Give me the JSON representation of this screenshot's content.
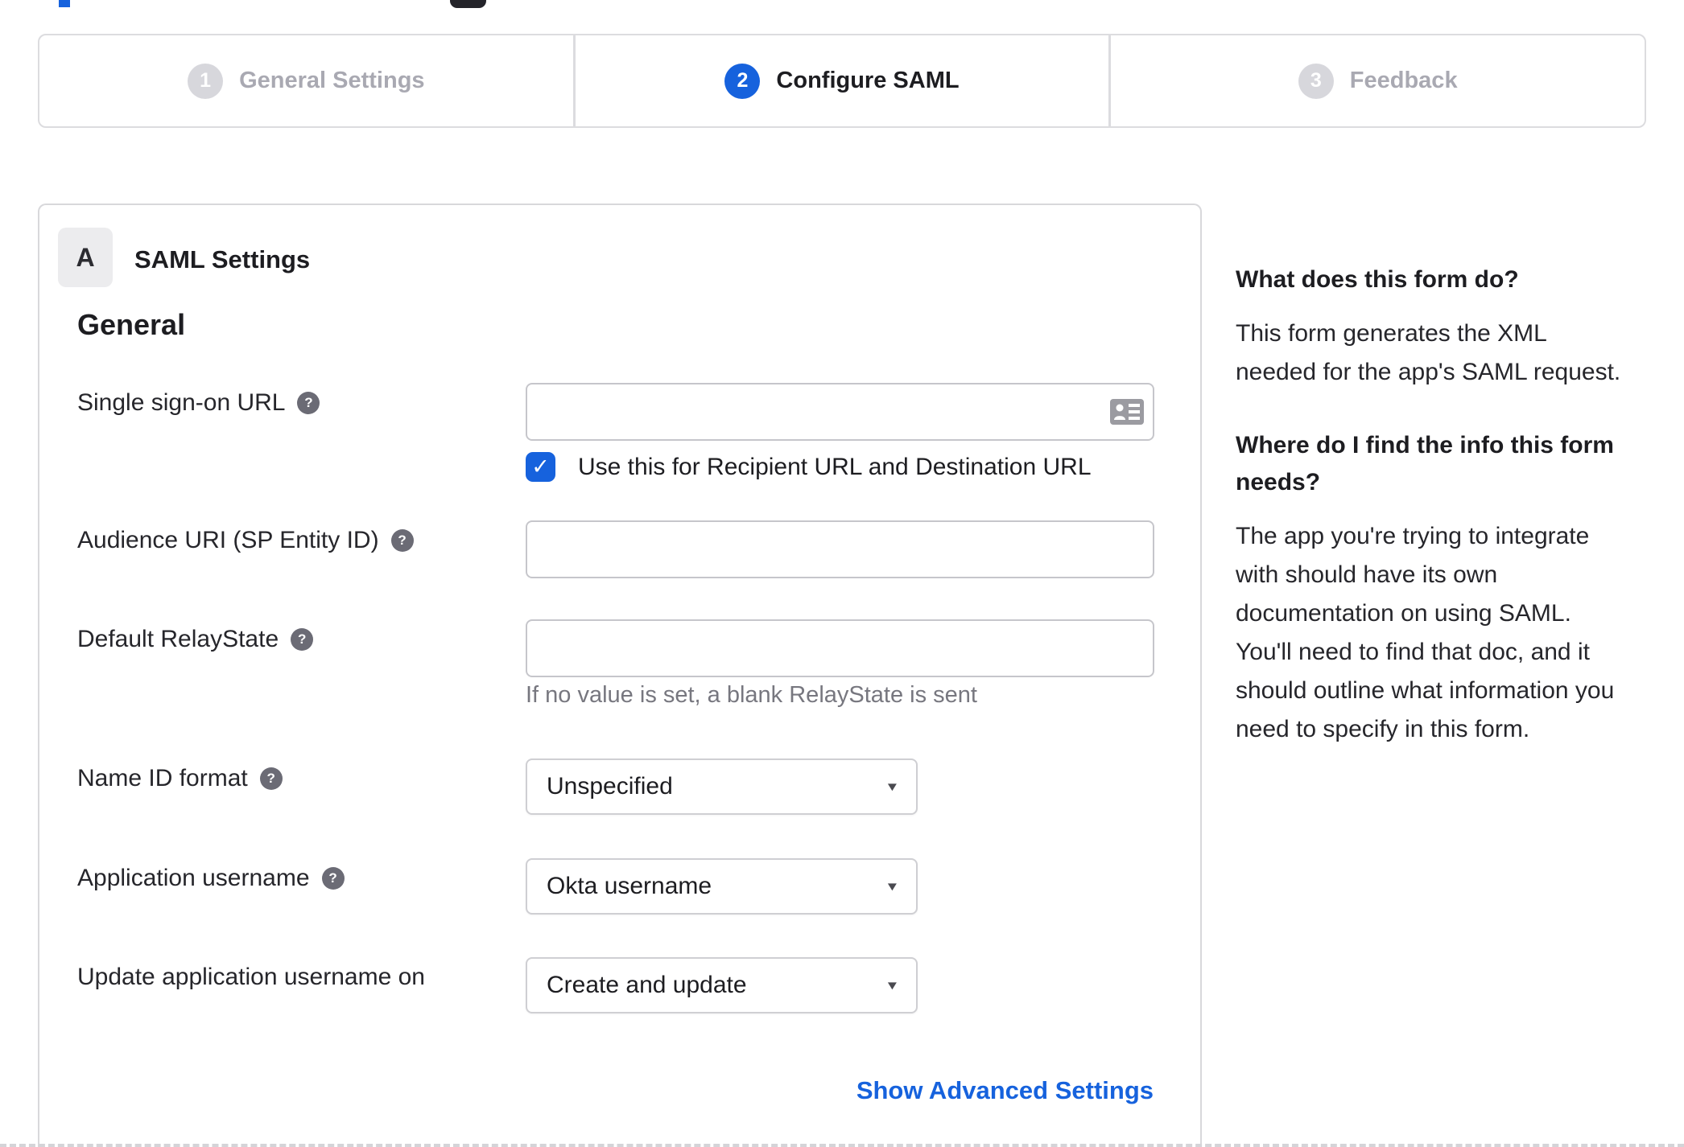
{
  "colors": {
    "accent_blue": "#1662dd",
    "border_gray": "#d8d8db",
    "text_dark": "#1d1d21",
    "muted_gray": "#a9a9b2",
    "hint_gray": "#77777f",
    "badge_bg": "#ececee",
    "help_icon_bg": "#6b6b75"
  },
  "glyphs": {
    "help": "?",
    "checkmark": "✓",
    "dropdown_arrow": "▼"
  },
  "stepper": {
    "steps": [
      {
        "number": "1",
        "label": "General Settings",
        "state": "inactive"
      },
      {
        "number": "2",
        "label": "Configure SAML",
        "state": "active"
      },
      {
        "number": "3",
        "label": "Feedback",
        "state": "inactive"
      }
    ]
  },
  "panel": {
    "section_badge": "A",
    "section_title": "SAML Settings",
    "group_title": "General",
    "fields": [
      {
        "label": "Single sign-on URL",
        "type": "text",
        "value": "",
        "has_help": true,
        "checkbox_label": "Use this for Recipient URL and Destination URL",
        "checkbox_checked": true
      },
      {
        "label": "Audience URI (SP Entity ID)",
        "type": "text",
        "value": "",
        "has_help": true
      },
      {
        "label": "Default RelayState",
        "type": "text",
        "value": "",
        "has_help": true,
        "hint": "If no value is set, a blank RelayState is sent"
      },
      {
        "label": "Name ID format",
        "type": "select",
        "value": "Unspecified",
        "has_help": true
      },
      {
        "label": "Application username",
        "type": "select",
        "value": "Okta username",
        "has_help": true
      },
      {
        "label": "Update application username on",
        "type": "select",
        "value": "Create and update",
        "has_help": false
      }
    ],
    "advanced_link": "Show Advanced Settings"
  },
  "sidebar": {
    "sections": [
      {
        "heading": "What does this form do?",
        "body": "This form generates the XML needed for the app's SAML request."
      },
      {
        "heading": "Where do I find the info this form needs?",
        "body": "The app you're trying to integrate with should have its own documentation on using SAML. You'll need to find that doc, and it should outline what information you need to specify in this form."
      }
    ]
  }
}
